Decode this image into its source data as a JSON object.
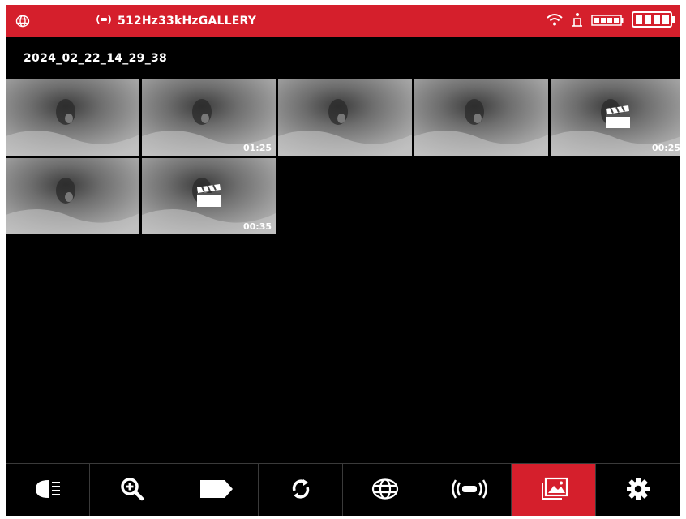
{
  "status_bar": {
    "grid_icon": "grid-globe-icon",
    "signal_icon": "sonde-signal-icon",
    "title": "512Hz33kHzGALLERY",
    "wifi_icon": "wifi-icon",
    "person_icon": "person-icon",
    "device_battery_icon": "device-battery-icon",
    "battery_icon": "battery-icon",
    "accent_color": "#d51f2c"
  },
  "gallery": {
    "folder_name": "2024_02_22_14_29_38",
    "items": [
      {
        "type": "photo",
        "duration": ""
      },
      {
        "type": "video",
        "duration": "01:25",
        "clapper": false
      },
      {
        "type": "photo",
        "duration": ""
      },
      {
        "type": "photo",
        "duration": ""
      },
      {
        "type": "video",
        "duration": "00:25",
        "clapper": true
      },
      {
        "type": "photo",
        "duration": ""
      },
      {
        "type": "video",
        "duration": "00:35",
        "clapper": true
      }
    ]
  },
  "toolbar": {
    "buttons": [
      {
        "icon": "headlight-icon",
        "active": false
      },
      {
        "icon": "zoom-in-icon",
        "active": false
      },
      {
        "icon": "tag-icon",
        "active": false
      },
      {
        "icon": "rotate-icon",
        "active": false
      },
      {
        "icon": "grid-globe-icon",
        "active": false
      },
      {
        "icon": "sonde-signal-icon",
        "active": false
      },
      {
        "icon": "gallery-icon",
        "active": true
      },
      {
        "icon": "settings-gear-icon",
        "active": false
      }
    ]
  }
}
